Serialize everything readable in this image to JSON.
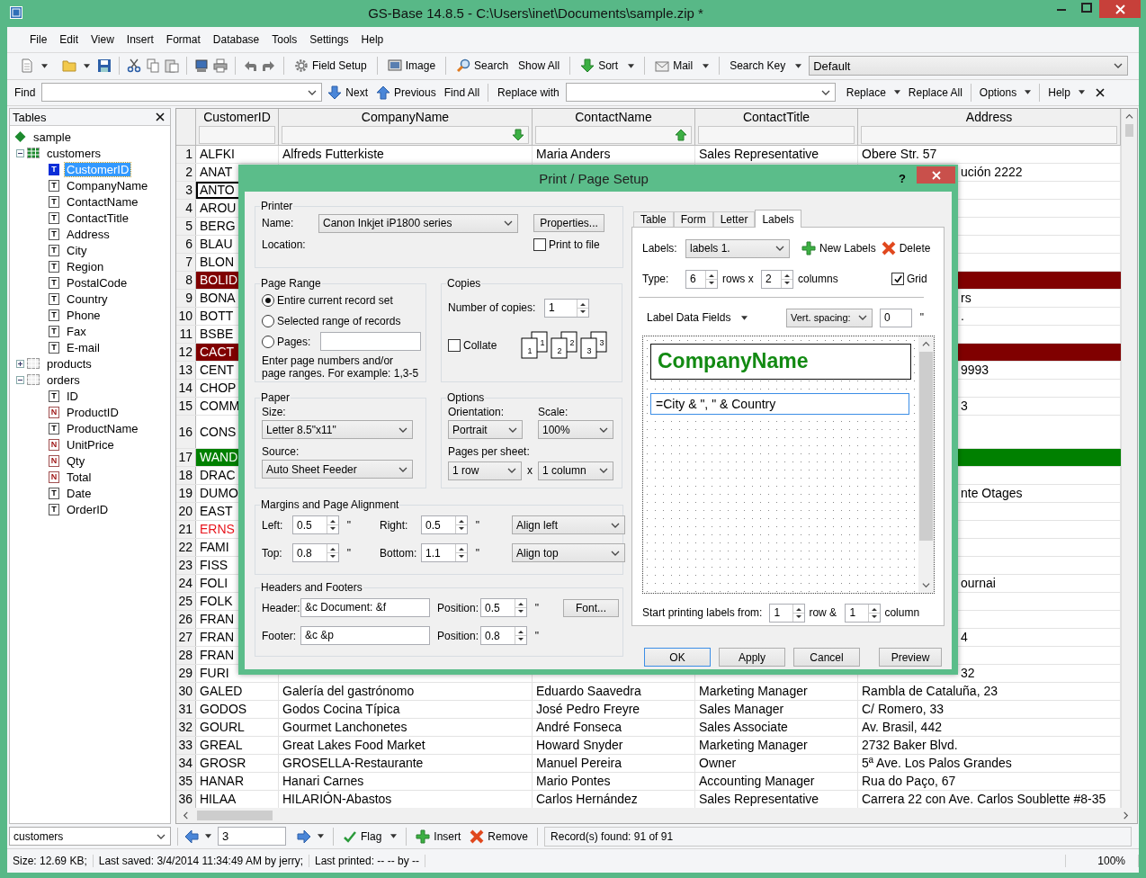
{
  "window": {
    "title": "GS-Base 14.8.5 - C:\\Users\\inet\\Documents\\sample.zip *"
  },
  "menu": [
    "File",
    "Edit",
    "View",
    "Insert",
    "Format",
    "Database",
    "Tools",
    "Settings",
    "Help"
  ],
  "toolbar": {
    "field_setup": "Field Setup",
    "image": "Image",
    "search": "Search",
    "show_all": "Show All",
    "sort": "Sort",
    "mail": "Mail",
    "search_key": "Search Key",
    "search_key_value": "Default"
  },
  "find_bar": {
    "find_label": "Find",
    "next": "Next",
    "previous": "Previous",
    "find_all": "Find All",
    "replace_with": "Replace with",
    "replace": "Replace",
    "replace_all": "Replace All",
    "options": "Options",
    "help": "Help"
  },
  "tables_panel": {
    "title": "Tables",
    "tree": [
      {
        "label": "sample",
        "children": [
          {
            "label": "customers",
            "expanded": true,
            "children": [
              {
                "label": "CustomerID",
                "badge": "T",
                "kind": "text",
                "selected": true
              },
              {
                "label": "CompanyName",
                "badge": "T",
                "kind": "text",
                "selected": false
              },
              {
                "label": "ContactName",
                "badge": "T",
                "kind": "text",
                "selected": false
              },
              {
                "label": "ContactTitle",
                "badge": "T",
                "kind": "text",
                "selected": false
              },
              {
                "label": "Address",
                "badge": "T",
                "kind": "text",
                "selected": false
              },
              {
                "label": "City",
                "badge": "T",
                "kind": "text",
                "selected": false
              },
              {
                "label": "Region",
                "badge": "T",
                "kind": "text",
                "selected": false
              },
              {
                "label": "PostalCode",
                "badge": "T",
                "kind": "text",
                "selected": false
              },
              {
                "label": "Country",
                "badge": "T",
                "kind": "text",
                "selected": false
              },
              {
                "label": "Phone",
                "badge": "T",
                "kind": "text",
                "selected": false
              },
              {
                "label": "Fax",
                "badge": "T",
                "kind": "text",
                "selected": false
              },
              {
                "label": "E-mail",
                "badge": "T",
                "kind": "text",
                "selected": false
              }
            ]
          },
          {
            "label": "products",
            "expanded": false
          },
          {
            "label": "orders",
            "expanded": true,
            "children": [
              {
                "label": "ID",
                "badge": "T",
                "kind": "text",
                "selected": false
              },
              {
                "label": "ProductID",
                "badge": "N",
                "kind": "number",
                "selected": false
              },
              {
                "label": "ProductName",
                "badge": "T",
                "kind": "text",
                "selected": false
              },
              {
                "label": "UnitPrice",
                "badge": "N",
                "kind": "number",
                "selected": false
              },
              {
                "label": "Qty",
                "badge": "N",
                "kind": "number",
                "selected": false
              },
              {
                "label": "Total",
                "badge": "N",
                "kind": "number",
                "selected": false
              },
              {
                "label": "Date",
                "badge": "T",
                "kind": "text",
                "selected": false
              },
              {
                "label": "OrderID",
                "badge": "T",
                "kind": "text",
                "selected": false
              }
            ]
          }
        ]
      }
    ]
  },
  "grid": {
    "columns": [
      {
        "label": "CustomerID",
        "kind": "plain"
      },
      {
        "label": "CompanyName",
        "kind": "sorted-down"
      },
      {
        "label": "ContactName",
        "kind": "sorted-up"
      },
      {
        "label": "ContactTitle",
        "kind": "plain"
      },
      {
        "label": "Address",
        "kind": "plain"
      }
    ],
    "rows": [
      {
        "num": "1",
        "kind": "plain",
        "selected": false,
        "id": "ALFKI",
        "company": "Alfreds Futterkiste",
        "contact": "Maria Anders",
        "title": "Sales Representative",
        "address": "Obere Str. 57"
      },
      {
        "num": "2",
        "kind": "plain",
        "selected": false,
        "id": "ANAT",
        "tail": "ución 2222"
      },
      {
        "num": "3",
        "kind": "plain",
        "selected": true,
        "id": "ANTO"
      },
      {
        "num": "4",
        "kind": "plain",
        "selected": false,
        "id": "AROU"
      },
      {
        "num": "5",
        "kind": "plain",
        "selected": false,
        "id": "BERG"
      },
      {
        "num": "6",
        "kind": "plain",
        "selected": false,
        "id": "BLAU"
      },
      {
        "num": "7",
        "kind": "plain",
        "selected": false,
        "id": "BLON"
      },
      {
        "num": "8",
        "kind": "band",
        "color": "#800000",
        "selected": false,
        "id": "BOLID"
      },
      {
        "num": "9",
        "kind": "plain",
        "selected": false,
        "id": "BONA",
        "tail": "rs"
      },
      {
        "num": "10",
        "kind": "plain",
        "selected": false,
        "id": "BOTT",
        "tail": "."
      },
      {
        "num": "11",
        "kind": "plain",
        "selected": false,
        "id": "BSBE"
      },
      {
        "num": "12",
        "kind": "band",
        "color": "#800000",
        "selected": false,
        "id": "CACT"
      },
      {
        "num": "13",
        "kind": "plain",
        "selected": false,
        "id": "CENT",
        "tail": "9993"
      },
      {
        "num": "14",
        "kind": "plain",
        "selected": false,
        "id": "CHOP"
      },
      {
        "num": "15",
        "kind": "plain",
        "selected": false,
        "id": "COMM",
        "tail": "3"
      },
      {
        "num": "16",
        "kind": "plain",
        "selected": false,
        "tall": true,
        "id": "CONS"
      },
      {
        "num": "17",
        "kind": "band",
        "color": "#008000",
        "selected": false,
        "id": "WAND"
      },
      {
        "num": "18",
        "kind": "plain",
        "selected": false,
        "id": "DRAC"
      },
      {
        "num": "19",
        "kind": "plain",
        "selected": false,
        "id": "DUMO",
        "tail": "nte Otages"
      },
      {
        "num": "20",
        "kind": "plain",
        "selected": false,
        "id": "EAST"
      },
      {
        "num": "21",
        "kind": "alert",
        "selected": false,
        "id": "ERNS"
      },
      {
        "num": "22",
        "kind": "plain",
        "selected": false,
        "id": "FAMI"
      },
      {
        "num": "23",
        "kind": "plain",
        "selected": false,
        "id": "FISS"
      },
      {
        "num": "24",
        "kind": "plain",
        "selected": false,
        "id": "FOLI",
        "tail": "ournai"
      },
      {
        "num": "25",
        "kind": "plain",
        "selected": false,
        "id": "FOLK"
      },
      {
        "num": "26",
        "kind": "plain",
        "selected": false,
        "id": "FRAN"
      },
      {
        "num": "27",
        "kind": "plain",
        "selected": false,
        "id": "FRAN",
        "tail": "4"
      },
      {
        "num": "28",
        "kind": "plain",
        "selected": false,
        "id": "FRAN"
      },
      {
        "num": "29",
        "kind": "plain",
        "selected": false,
        "id": "FURI",
        "tail": "32"
      },
      {
        "num": "30",
        "kind": "plain",
        "selected": false,
        "id": "GALED",
        "company": "Galería del gastrónomo",
        "contact": "Eduardo Saavedra",
        "title": "Marketing Manager",
        "address": "Rambla de Cataluña, 23"
      },
      {
        "num": "31",
        "kind": "plain",
        "selected": false,
        "id": "GODOS",
        "company": "Godos Cocina Típica",
        "contact": "José Pedro Freyre",
        "title": "Sales Manager",
        "address": "C/ Romero, 33"
      },
      {
        "num": "32",
        "kind": "plain",
        "selected": false,
        "id": "GOURL",
        "company": "Gourmet Lanchonetes",
        "contact": "André Fonseca",
        "title": "Sales Associate",
        "address": "Av. Brasil, 442"
      },
      {
        "num": "33",
        "kind": "plain",
        "selected": false,
        "id": "GREAL",
        "company": "Great Lakes Food Market",
        "contact": "Howard Snyder",
        "title": "Marketing Manager",
        "address": "2732 Baker Blvd."
      },
      {
        "num": "34",
        "kind": "plain",
        "selected": false,
        "id": "GROSR",
        "company": "GROSELLA-Restaurante",
        "contact": "Manuel Pereira",
        "title": "Owner",
        "address": "5ª Ave. Los Palos Grandes"
      },
      {
        "num": "35",
        "kind": "plain",
        "selected": false,
        "id": "HANAR",
        "company": "Hanari Carnes",
        "contact": "Mario Pontes",
        "title": "Accounting Manager",
        "address": "Rua do Paço, 67"
      },
      {
        "num": "36",
        "kind": "plain",
        "selected": false,
        "id": "HILAA",
        "company": "HILARIÓN-Abastos",
        "contact": "Carlos Hernández",
        "title": "Sales Representative",
        "address": "Carrera 22 con Ave. Carlos Soublette #8-35"
      }
    ]
  },
  "dialog": {
    "title": "Print / Page Setup",
    "help": "?",
    "printer": {
      "title": "Printer",
      "name_label": "Name:",
      "name": "Canon Inkjet iP1800 series",
      "properties": "Properties...",
      "location_label": "Location:",
      "print_to_file": {
        "label": "Print to file",
        "checked": false
      }
    },
    "page_range": {
      "title": "Page Range",
      "options": [
        {
          "label": "Entire current record set",
          "selected": true
        },
        {
          "label": "Selected range of records",
          "selected": false
        },
        {
          "label": "Pages:",
          "selected": false
        }
      ],
      "note": "Enter page numbers and/or page ranges. For example: 1,3-5"
    },
    "copies": {
      "title": "Copies",
      "label": "Number of copies:",
      "value": "1",
      "collate": {
        "label": "Collate",
        "checked": false
      },
      "collate_pages": [
        "1",
        "1",
        "2",
        "2",
        "3",
        "3"
      ]
    },
    "paper": {
      "title": "Paper",
      "size_label": "Size:",
      "size": "Letter 8.5\"x11\"",
      "source_label": "Source:",
      "source": "Auto Sheet Feeder"
    },
    "options": {
      "title": "Options",
      "orientation_label": "Orientation:",
      "orientation": "Portrait",
      "scale_label": "Scale:",
      "scale": "100%",
      "pages_per_sheet_label": "Pages per sheet:",
      "rows": "1 row",
      "times": "x",
      "columns": "1 column"
    },
    "margins": {
      "title": "Margins and Page Alignment",
      "fields": [
        {
          "label": "Left:",
          "value": "0.5",
          "unit": "\""
        },
        {
          "label": "Right:",
          "value": "0.5",
          "unit": "\""
        },
        {
          "label": "Top:",
          "value": "0.8",
          "unit": "\""
        },
        {
          "label": "Bottom:",
          "value": "1.1",
          "unit": "\""
        }
      ],
      "h_align": "Align left",
      "v_align": "Align top"
    },
    "headers_footers": {
      "title": "Headers and Footers",
      "header_label": "Header:",
      "header": "&c Document: &f",
      "footer_label": "Footer:",
      "footer": "&c &p",
      "positions": [
        {
          "label": "Position:",
          "value": "0.5",
          "unit": "\""
        },
        {
          "label": "Position:",
          "value": "0.8",
          "unit": "\""
        }
      ],
      "font": "Font..."
    },
    "tabs": [
      {
        "label": "Table",
        "selected": false
      },
      {
        "label": "Form",
        "selected": false
      },
      {
        "label": "Letter",
        "selected": false
      },
      {
        "label": "Labels",
        "selected": true
      }
    ],
    "labels": {
      "labels_label": "Labels:",
      "labels_value": "labels 1.",
      "new_labels": "New Labels",
      "delete": "Delete",
      "type_label": "Type:",
      "rows": "6",
      "rows_x": "rows x",
      "columns": "2",
      "columns_label": "columns",
      "grid": {
        "label": "Grid",
        "checked": true
      },
      "data_fields": "Label Data Fields",
      "vert_spacing": "Vert. spacing:",
      "spacing_value": "0",
      "spacing_unit": "\"",
      "canvas_title": "CompanyName",
      "canvas_formula": "=City & \", \" & Country",
      "start_label": "Start printing labels from:",
      "start_row": "1",
      "row_amp": "row &",
      "start_column": "1",
      "column_label": "column"
    },
    "buttons": [
      "OK",
      "Apply",
      "Cancel",
      "Preview"
    ]
  },
  "bottom_bar": {
    "table": "customers",
    "record": "3",
    "flag": "Flag",
    "insert": "Insert",
    "remove": "Remove",
    "found": "Record(s) found: 91 of 91"
  },
  "status_bar": {
    "size": "Size: 12.69 KB;",
    "saved": "Last saved: 3/4/2014 11:34:49 AM by jerry;",
    "printed": "Last printed: -- -- by --",
    "zoom": "100%"
  }
}
